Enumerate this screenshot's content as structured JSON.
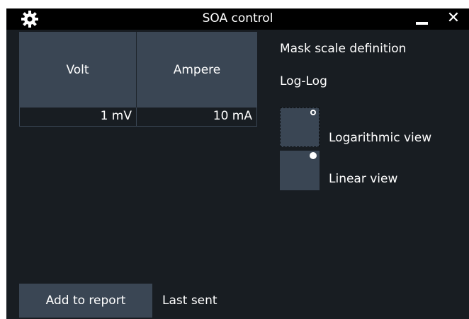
{
  "window": {
    "title": "SOA control",
    "close_glyph": "✕",
    "icons": {
      "settings": "gear-icon",
      "minimize": "minimize-icon",
      "close": "close-icon"
    }
  },
  "table": {
    "headers": [
      "Volt",
      "Ampere"
    ],
    "rows": [
      [
        "1 mV",
        "10 mA"
      ]
    ]
  },
  "mask": {
    "title": "Mask scale definition",
    "value": "Log-Log",
    "options": [
      {
        "label": "Logarithmic view",
        "selected": false
      },
      {
        "label": "Linear view",
        "selected": true
      }
    ]
  },
  "footer": {
    "report_button": "Add to report",
    "last_sent": "Last sent"
  },
  "colors": {
    "background": "#181d22",
    "titlebar": "#000000",
    "button": "#3a4654",
    "text": "#ffffff"
  }
}
